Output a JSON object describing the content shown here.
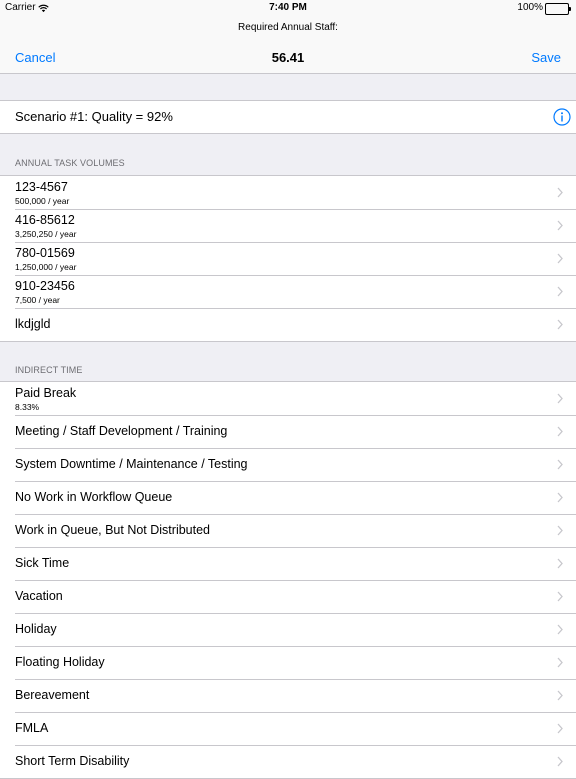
{
  "status_bar": {
    "carrier": "Carrier",
    "time": "7:40 PM",
    "battery": "100%"
  },
  "nav": {
    "prompt": "Required Annual Staff:",
    "title": "56.41",
    "cancel_label": "Cancel",
    "save_label": "Save"
  },
  "scenario": {
    "title": "Scenario #1: Quality = 92%",
    "info_icon": "info-circle-icon"
  },
  "task_volumes": {
    "header": "ANNUAL TASK VOLUMES",
    "items": [
      {
        "title": "123-4567",
        "subtitle": "500,000 / year"
      },
      {
        "title": "416-85612",
        "subtitle": "3,250,250 / year"
      },
      {
        "title": "780-01569",
        "subtitle": "1,250,000 / year"
      },
      {
        "title": "910-23456",
        "subtitle": "7,500 / year"
      },
      {
        "title": "lkdjgld",
        "subtitle": ""
      }
    ]
  },
  "indirect_time": {
    "header": "INDIRECT TIME",
    "items": [
      {
        "title": "Paid Break",
        "subtitle": "8.33%"
      },
      {
        "title": "Meeting / Staff Development / Training",
        "subtitle": ""
      },
      {
        "title": "System Downtime / Maintenance / Testing",
        "subtitle": ""
      },
      {
        "title": "No Work in Workflow Queue",
        "subtitle": ""
      },
      {
        "title": "Work in Queue, But Not Distributed",
        "subtitle": ""
      },
      {
        "title": "Sick Time",
        "subtitle": ""
      },
      {
        "title": "Vacation",
        "subtitle": ""
      },
      {
        "title": "Holiday",
        "subtitle": ""
      },
      {
        "title": "Floating Holiday",
        "subtitle": ""
      },
      {
        "title": "Bereavement",
        "subtitle": ""
      },
      {
        "title": "FMLA",
        "subtitle": ""
      },
      {
        "title": "Short Term Disability",
        "subtitle": ""
      }
    ]
  },
  "colors": {
    "accent": "#007aff",
    "background": "#efeff4",
    "separator": "#c8c7cc",
    "chevron": "#c7c7cc",
    "section_header": "#6d6d72"
  }
}
